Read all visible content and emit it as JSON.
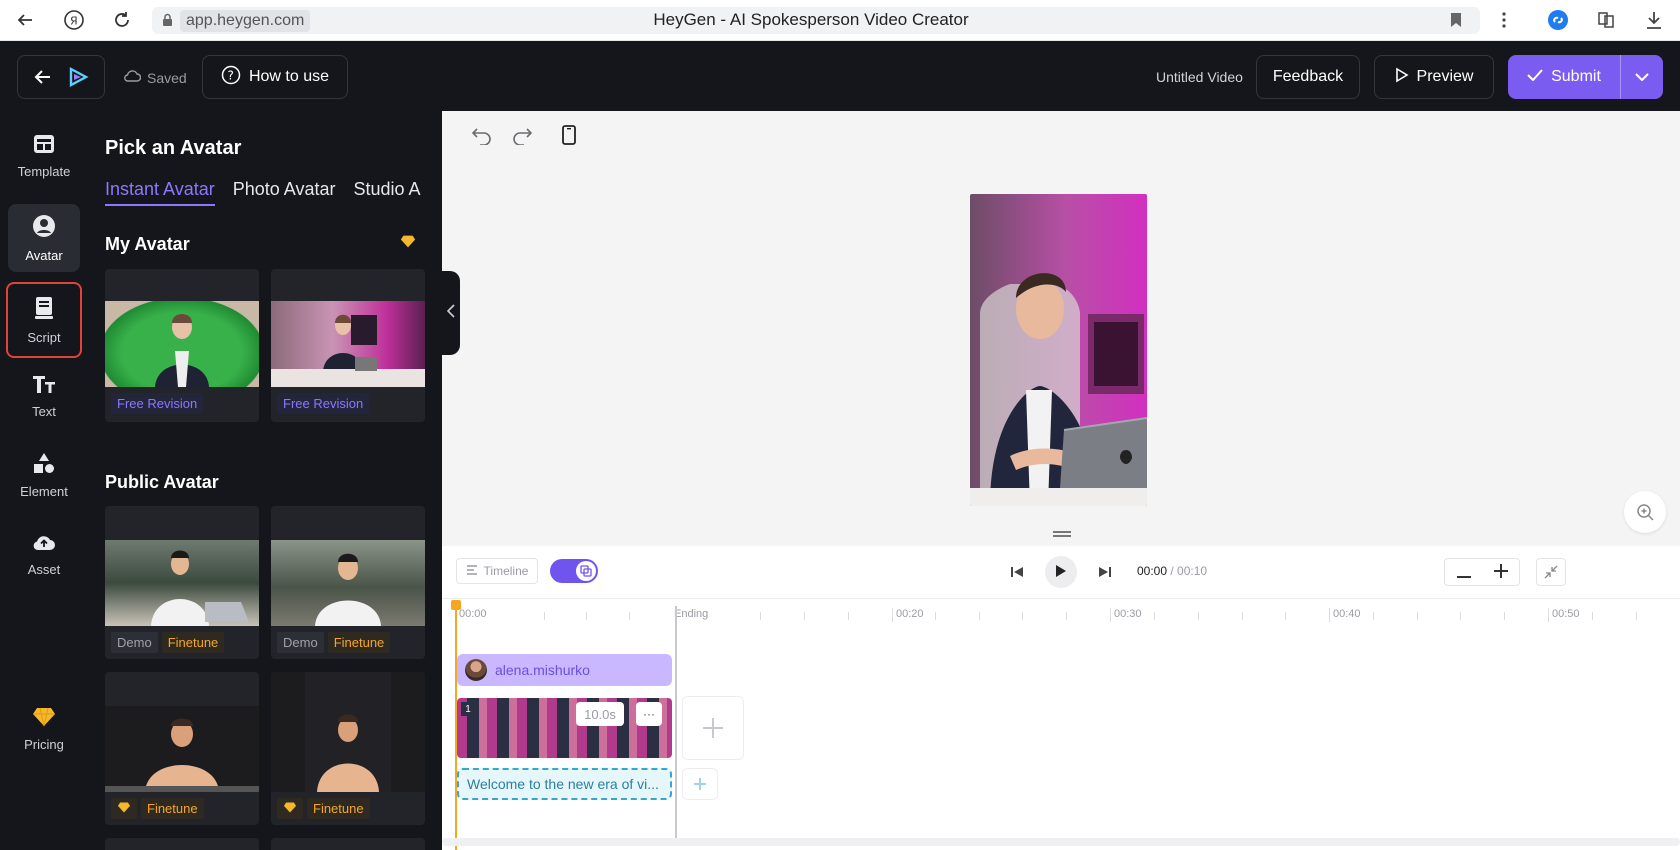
{
  "browser": {
    "url": "app.heygen.com",
    "page_title": "HeyGen - AI Spokesperson Video Creator",
    "icons": [
      "back-arrow-icon",
      "yandex-icon",
      "reload-icon",
      "lock-icon",
      "bookmark-icon",
      "more-vert-icon",
      "shazam-icon",
      "collections-icon",
      "download-icon"
    ]
  },
  "header": {
    "saved_label": "Saved",
    "how_to_use_label": "How to use",
    "video_title": "Untitled Video",
    "feedback_label": "Feedback",
    "preview_label": "Preview",
    "submit_label": "Submit"
  },
  "rail": {
    "items": [
      {
        "label": "Template",
        "icon": "template-icon"
      },
      {
        "label": "Avatar",
        "icon": "avatar-icon"
      },
      {
        "label": "Script",
        "icon": "script-icon"
      },
      {
        "label": "Text",
        "icon": "text-icon"
      },
      {
        "label": "Element",
        "icon": "element-icon"
      },
      {
        "label": "Asset",
        "icon": "cloud-upload-icon"
      }
    ],
    "pricing_label": "Pricing"
  },
  "panel": {
    "title": "Pick an Avatar",
    "tabs": [
      {
        "label": "Instant Avatar",
        "active": true
      },
      {
        "label": "Photo Avatar",
        "active": false
      },
      {
        "label": "Studio A",
        "active": false
      }
    ],
    "my_avatar_title": "My Avatar",
    "public_avatar_title": "Public Avatar",
    "my_avatars": [
      {
        "tag": "Free Revision",
        "bg": "green"
      },
      {
        "tag": "Free Revision",
        "bg": "office"
      }
    ],
    "public_avatars": [
      {
        "tags": [
          "Demo",
          "Finetune"
        ]
      },
      {
        "tags": [
          "Demo",
          "Finetune"
        ]
      },
      {
        "tags": [
          "Finetune"
        ],
        "gem": true
      },
      {
        "tags": [
          "Finetune"
        ],
        "gem": true
      }
    ]
  },
  "timeline": {
    "timeline_label": "Timeline",
    "current_time": "00:00",
    "total_time": "/ 00:10",
    "ticks": [
      "00:00",
      "Ending",
      "00:20",
      "00:30",
      "00:40",
      "00:50"
    ],
    "avatar_track_label": "alena.mishurko",
    "clip_number": "1",
    "clip_duration": "10.0s",
    "clip_more": "···",
    "script_preview": "Welcome to the new era of vi..."
  },
  "colors": {
    "accent": "#7b5cf0",
    "dark_bg": "#15161b",
    "highlight_border": "#e0433c",
    "playhead": "#f5a623"
  }
}
